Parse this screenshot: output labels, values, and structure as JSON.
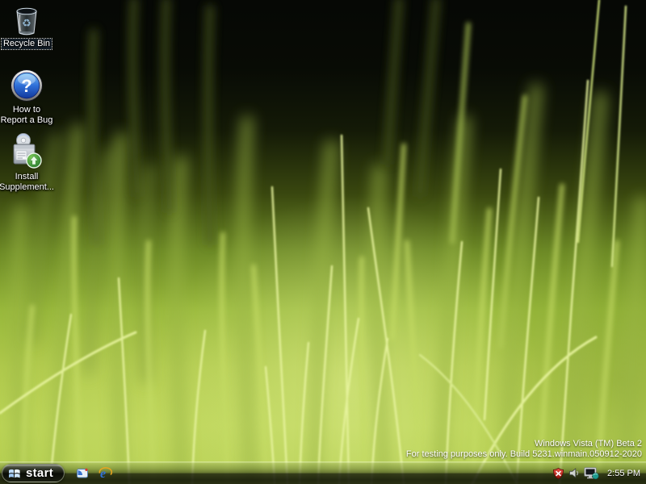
{
  "desktop": {
    "watermark": {
      "line1": "Windows Vista (TM) Beta 2",
      "line2": "For testing purposes only. Build 5231.winmain.050912-2020"
    },
    "icons": [
      {
        "line1": "Recycle Bin",
        "line2": ""
      },
      {
        "line1": "How to",
        "line2": "Report a Bug"
      },
      {
        "line1": "Install",
        "line2": "Supplement..."
      }
    ]
  },
  "taskbar": {
    "start_label": "start",
    "clock": "2:55 PM",
    "quick_launch_icons": [
      "app-window-icon",
      "internet-explorer-icon"
    ],
    "tray_icons": [
      "security-alert-shield-icon",
      "volume-speaker-icon",
      "network-status-icon"
    ]
  },
  "glyphs": {
    "help": "?",
    "ie": "e",
    "recycle": "♻"
  },
  "colors": {
    "grass_bright": "#b9d254",
    "grass_mid": "#8aa53a",
    "sky_dark": "#070905",
    "security_shield_red": "#c81e12",
    "ie_blue": "#3071d8",
    "badge_green": "#2f9e3f"
  }
}
